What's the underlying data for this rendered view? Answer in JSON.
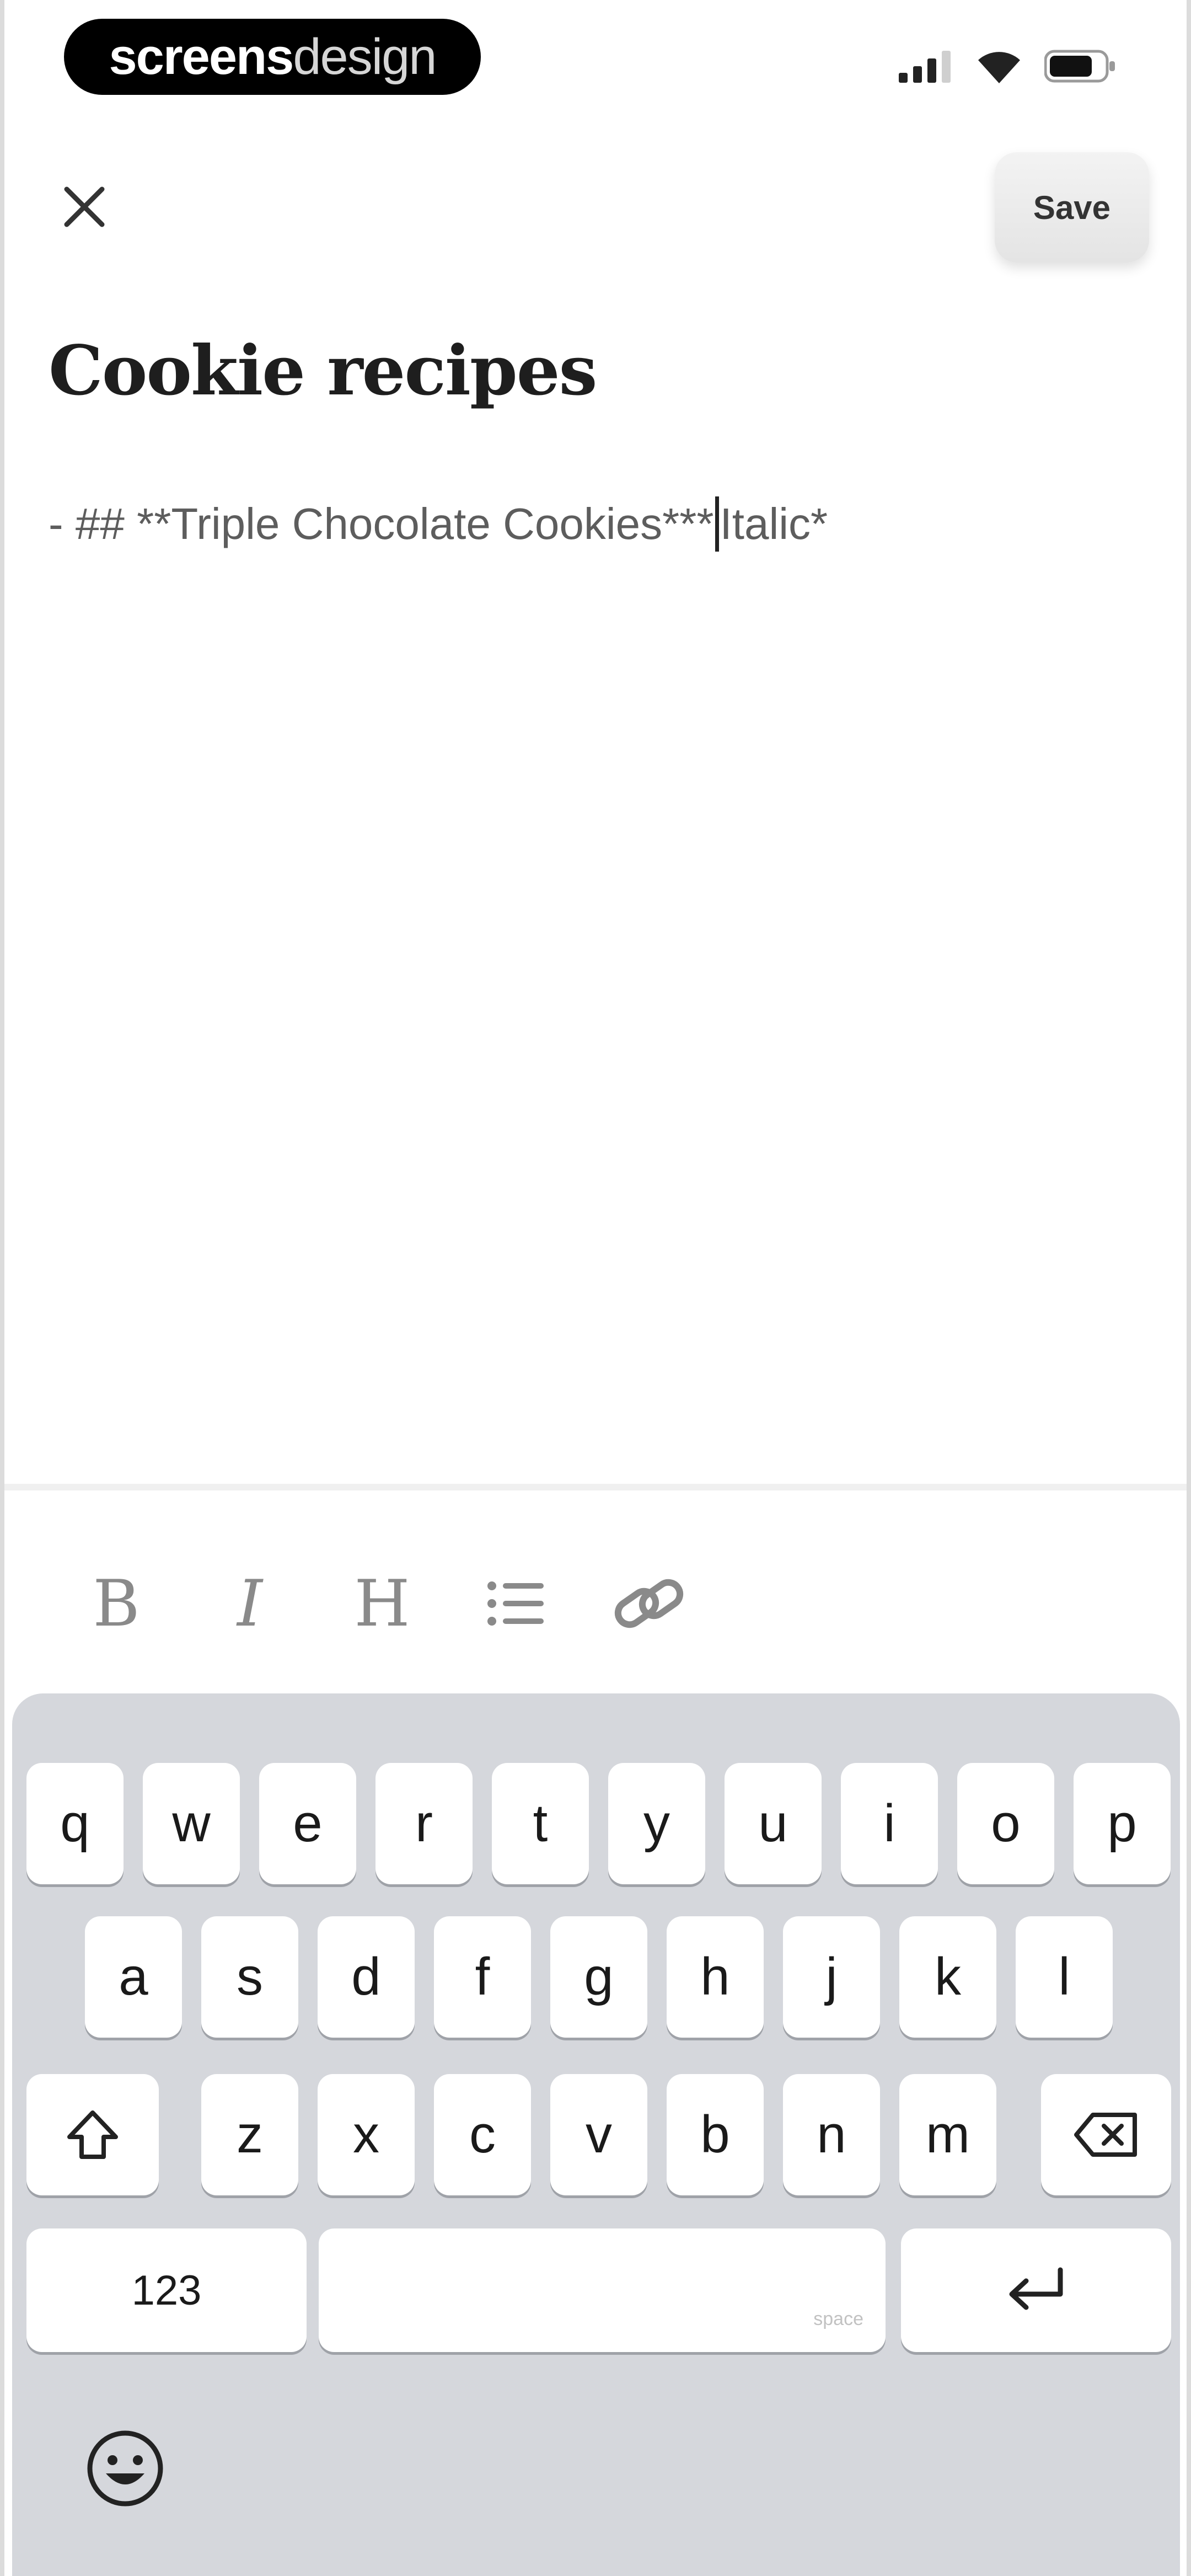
{
  "status_bar": {
    "brand_left": "screens",
    "brand_right": "design",
    "icons": [
      "cellular-signal-icon",
      "wifi-icon",
      "battery-icon"
    ]
  },
  "header": {
    "close_icon": "close-icon",
    "save_label": "Save"
  },
  "note": {
    "title": "Cookie recipes",
    "content_before_caret": "- ## **Triple Chocolate Cookies***",
    "content_after_caret": "Italic*"
  },
  "format_toolbar": {
    "bold": "B",
    "italic": "I",
    "heading": "H",
    "list_icon": "list-bullets-icon",
    "link_icon": "link-icon"
  },
  "keyboard": {
    "row1": [
      "q",
      "w",
      "e",
      "r",
      "t",
      "y",
      "u",
      "i",
      "o",
      "p"
    ],
    "row2": [
      "a",
      "s",
      "d",
      "f",
      "g",
      "h",
      "j",
      "k",
      "l"
    ],
    "row3": [
      "z",
      "x",
      "c",
      "v",
      "b",
      "n",
      "m"
    ],
    "numbers_label": "123",
    "space_hint": "space",
    "shift_icon": "shift-icon",
    "delete_icon": "backspace-icon",
    "return_icon": "return-icon",
    "emoji_icon": "emoji-icon"
  },
  "colors": {
    "keyboard_bg": "#d5d7dc",
    "key_bg": "#ffffff",
    "toolbar_icon": "#8a8a8a"
  }
}
